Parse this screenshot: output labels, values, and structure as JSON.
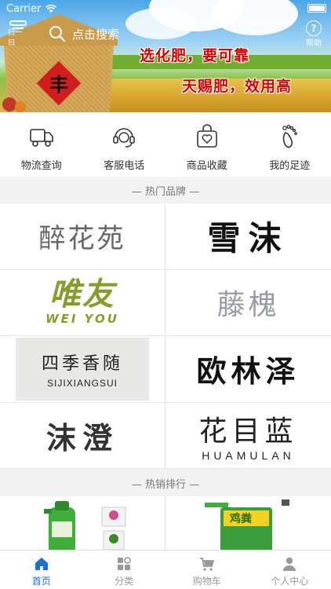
{
  "status_bar": {
    "carrier": "Carrier"
  },
  "header": {
    "scan_label": "扫一扫",
    "search_placeholder": "点击搜索",
    "help_label": "帮助"
  },
  "banner": {
    "line1": "选化肥，要可靠",
    "line2": "天赐肥，效用高",
    "sack_char": "丰"
  },
  "quick_actions": [
    {
      "label": "物流查询",
      "icon": "truck-icon"
    },
    {
      "label": "客服电话",
      "icon": "headset-icon"
    },
    {
      "label": "商品收藏",
      "icon": "favorite-bag-icon"
    },
    {
      "label": "我的足迹",
      "icon": "footprint-icon"
    }
  ],
  "sections": {
    "hot_brands": "— 热门品牌 —",
    "hot_sales": "— 热销排行 —"
  },
  "brands": [
    {
      "name": "醉花苑"
    },
    {
      "name": "雪沫"
    },
    {
      "name": "唯友",
      "sub": "WEI YOU"
    },
    {
      "name": "藤槐"
    },
    {
      "name": "四季香随",
      "sub": "SIJIXIANGSUI"
    },
    {
      "name": "欧林泽"
    },
    {
      "name": "沫澄"
    },
    {
      "name": "花目蓝",
      "sub": "HUAMULAN"
    }
  ],
  "hot_products": [
    {
      "package_text": ""
    },
    {
      "package_text": "鸡粪"
    }
  ],
  "tabbar": [
    {
      "label": "首页",
      "icon": "home-icon",
      "active": true
    },
    {
      "label": "分类",
      "icon": "category-icon",
      "active": false
    },
    {
      "label": "购物车",
      "icon": "cart-icon",
      "active": false
    },
    {
      "label": "个人中心",
      "icon": "user-icon",
      "active": false
    }
  ],
  "colors": {
    "accent": "#1a6fd1",
    "banner_text": "#d40000",
    "section_bg": "#f2f2f2"
  }
}
